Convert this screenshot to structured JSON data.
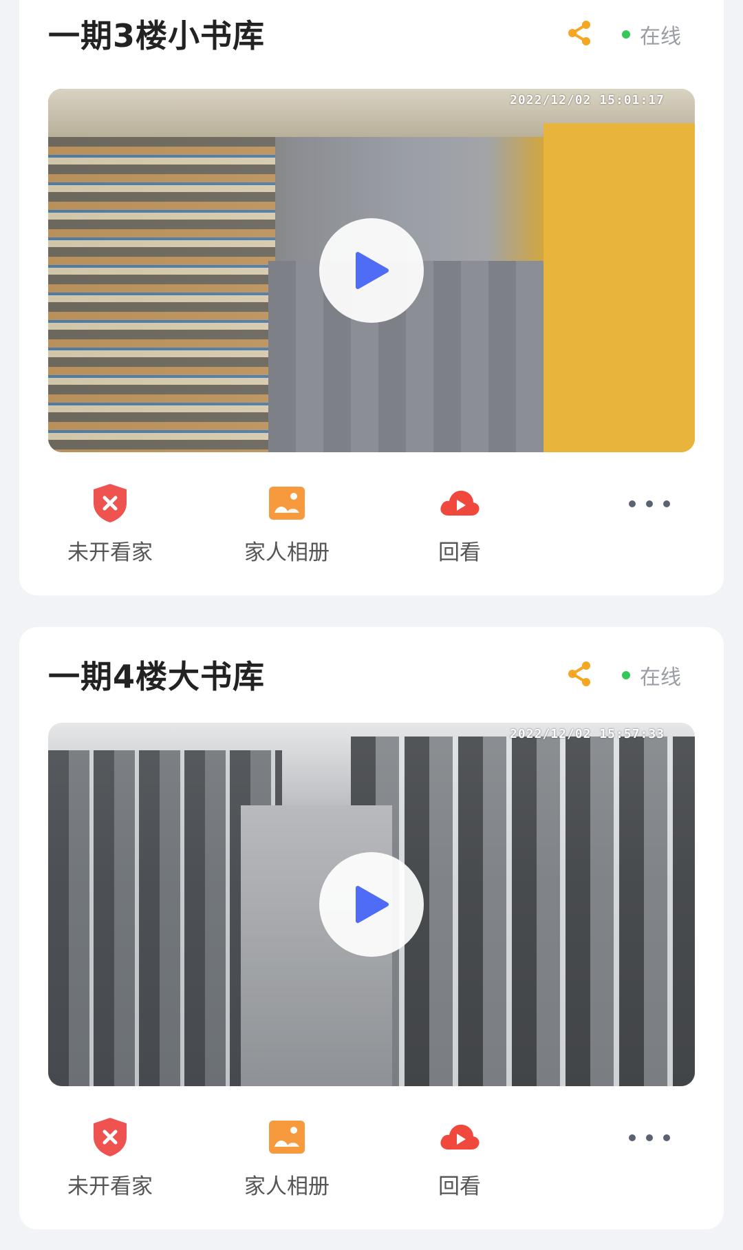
{
  "cameras": [
    {
      "title": "一期3楼小书库",
      "status": "在线",
      "timestamp": "2022/12/02  15:01:17",
      "actions": [
        "未开看家",
        "家人相册",
        "回看"
      ]
    },
    {
      "title": "一期4楼大书库",
      "status": "在线",
      "timestamp": "2022/12/02  15:57:33",
      "actions": [
        "未开看家",
        "家人相册",
        "回看"
      ]
    }
  ],
  "colors": {
    "share": "#f5a623",
    "online_dot": "#34c759",
    "play": "#4f6cf7",
    "alarm_red": "#ef5350",
    "album_orange": "#f79a3e",
    "playback_red": "#f1483e"
  },
  "icons": {
    "share": "share-icon",
    "play": "play-icon",
    "guard_off": "shield-x-icon",
    "album": "photo-album-icon",
    "playback": "cloud-play-icon",
    "more": "more-dots-icon"
  }
}
